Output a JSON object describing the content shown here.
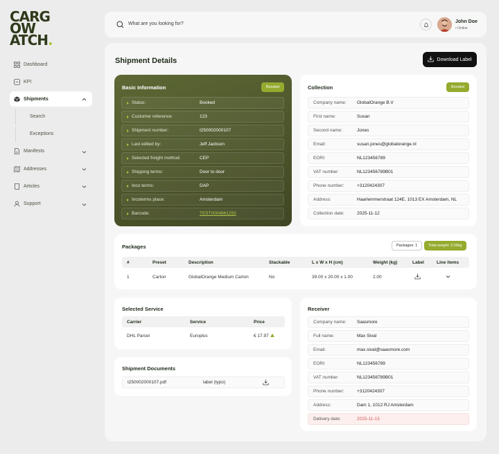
{
  "logo": {
    "lines": [
      "CARG",
      "OW",
      "ATCH"
    ],
    "dot": "."
  },
  "sidebar": {
    "items": [
      {
        "label": "Dashboard",
        "icon": "grid-icon"
      },
      {
        "label": "KPI",
        "icon": "kpi-icon"
      },
      {
        "label": "Shipments",
        "icon": "box-icon",
        "expanded": true
      },
      {
        "label": "Search"
      },
      {
        "label": "Exceptions"
      },
      {
        "label": "Manifests",
        "icon": "document-icon"
      },
      {
        "label": "Addresses",
        "icon": "map-icon"
      },
      {
        "label": "Articles",
        "icon": "book-icon"
      },
      {
        "label": "Support",
        "icon": "user-icon"
      }
    ]
  },
  "topbar": {
    "search_placeholder": "What are you looking for?",
    "user_name": "John Doe",
    "user_status": "• Online"
  },
  "page": {
    "title": "Shipment Details",
    "download_label": "Download Label"
  },
  "basic_info": {
    "title": "Basic Information",
    "badge": "Bonded",
    "rows": [
      {
        "label": "Status:",
        "value": "Booked"
      },
      {
        "label": "Customer reference:",
        "value": "123"
      },
      {
        "label": "Shipment number:",
        "value": "t250002000107"
      },
      {
        "label": "Last edited by:",
        "value": "Jeff Jackson"
      },
      {
        "label": "Selected freight method:",
        "value": "CEP"
      },
      {
        "label": "Shipping terms:",
        "value": "Door to door"
      },
      {
        "label": "Inco terms:",
        "value": "DAP"
      },
      {
        "label": "Incoterms place:",
        "value": "Amsterdam"
      },
      {
        "label": "Barcode:",
        "value": "TEST0004861250"
      }
    ]
  },
  "collection": {
    "title": "Collection",
    "badge": "Bonded",
    "rows": [
      {
        "label": "Company name:",
        "value": "GlobalOrange B.V"
      },
      {
        "label": "First name:",
        "value": "Susan"
      },
      {
        "label": "Second name:",
        "value": "Jones"
      },
      {
        "label": "Email:",
        "value": "susan.jones@globalorange.nl"
      },
      {
        "label": "EORI:",
        "value": "NL123456789"
      },
      {
        "label": "VAT number",
        "value": "NL123456789B01"
      },
      {
        "label": "Phone number:",
        "value": "+3120424307"
      },
      {
        "label": "Address:",
        "value": "Haarlemmerstraat 124E, 1013 EX Amsterdam, NL"
      },
      {
        "label": "Collection date:",
        "value": "2025-11-12"
      }
    ]
  },
  "packages": {
    "title": "Packages",
    "count_chip": "Packages: 1",
    "weight_chip": "Total weight: 2.00kg",
    "headers": [
      "#",
      "Preset",
      "Description",
      "Stackable",
      "L x W x H (cm)",
      "Weight (kg)",
      "Label",
      "Line items"
    ],
    "rows": [
      {
        "num": "1",
        "preset": "Carton",
        "description": "GlobalOrange Medium Carton",
        "stackable": "No",
        "dims": "39.00 x 20.00 x 1.00",
        "weight": "2.00"
      }
    ]
  },
  "service": {
    "title": "Selected Service",
    "headers": [
      "Carrier",
      "Service",
      "Price"
    ],
    "rows": [
      {
        "carrier": "DHL Parcel",
        "service": "Europlus",
        "price": "€ 17.97"
      }
    ]
  },
  "documents": {
    "title": "Shipment Documents",
    "rows": [
      {
        "file": "t250002000107.pdf",
        "type": "label (typo)"
      }
    ]
  },
  "receiver": {
    "title": "Receiver",
    "rows": [
      {
        "label": "Company name:",
        "value": "Saasmore"
      },
      {
        "label": "Full name:",
        "value": "Max Sival"
      },
      {
        "label": "Email:",
        "value": "max.sival@saasmore.com"
      },
      {
        "label": "EORI:",
        "value": "NL123456789"
      },
      {
        "label": "VAT number",
        "value": "NL123456789B01"
      },
      {
        "label": "Phone number:",
        "value": "+3120424307"
      },
      {
        "label": "Address:",
        "value": "Dam 1, 1012 RJ Amsterdam"
      },
      {
        "label": "Delivery date:",
        "value": "2025-11-13"
      }
    ]
  },
  "colors": {
    "accent": "#94ab2e",
    "dark_card": "#4a5329",
    "danger": "#d45757"
  }
}
